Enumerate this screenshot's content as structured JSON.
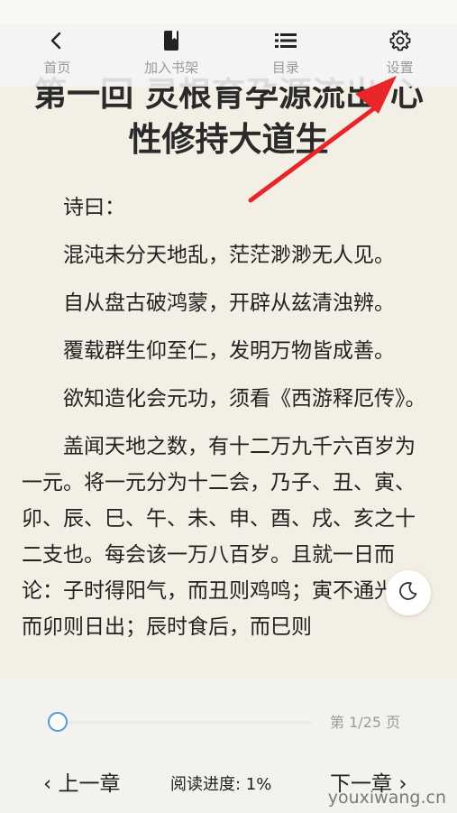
{
  "toolbar": {
    "items": [
      {
        "label": "首页",
        "icon": "back-arrow-icon"
      },
      {
        "label": "加入书架",
        "icon": "bookmark-book-icon"
      },
      {
        "label": "目录",
        "icon": "list-icon"
      },
      {
        "label": "设置",
        "icon": "gear-icon"
      }
    ]
  },
  "chapter": {
    "title_line1": "第一回 灵根育孕源流出 心",
    "title_line2": "性修持大道生",
    "paragraphs": [
      "诗曰：",
      "混沌未分天地乱，茫茫渺渺无人见。",
      "自从盘古破鸿蒙，开辟从兹清浊辨。",
      "覆载群生仰至仁，发明万物皆成善。",
      "欲知造化会元功，须看《西游释厄传》。",
      "盖闻天地之数，有十二万九千六百岁为一元。将一元分为十二会，乃子、丑、寅、卯、辰、巳、午、未、申、酉、戌、亥之十二支也。每会该一万八百岁。且就一日而论：子时得阳气，而丑则鸡鸣；寅不通光，而卯则日出；辰时食后，而巳则"
    ]
  },
  "bottom": {
    "page_indicator": "第 1/25 页",
    "prev_label": "上一章",
    "next_label": "下一章",
    "progress_label": "阅读进度: 1%",
    "progress_value": 0.01
  },
  "watermark": "youxiwang.cn",
  "colors": {
    "accent": "#4a9be8",
    "arrow": "#e8262a",
    "background": "#f3efe4"
  }
}
